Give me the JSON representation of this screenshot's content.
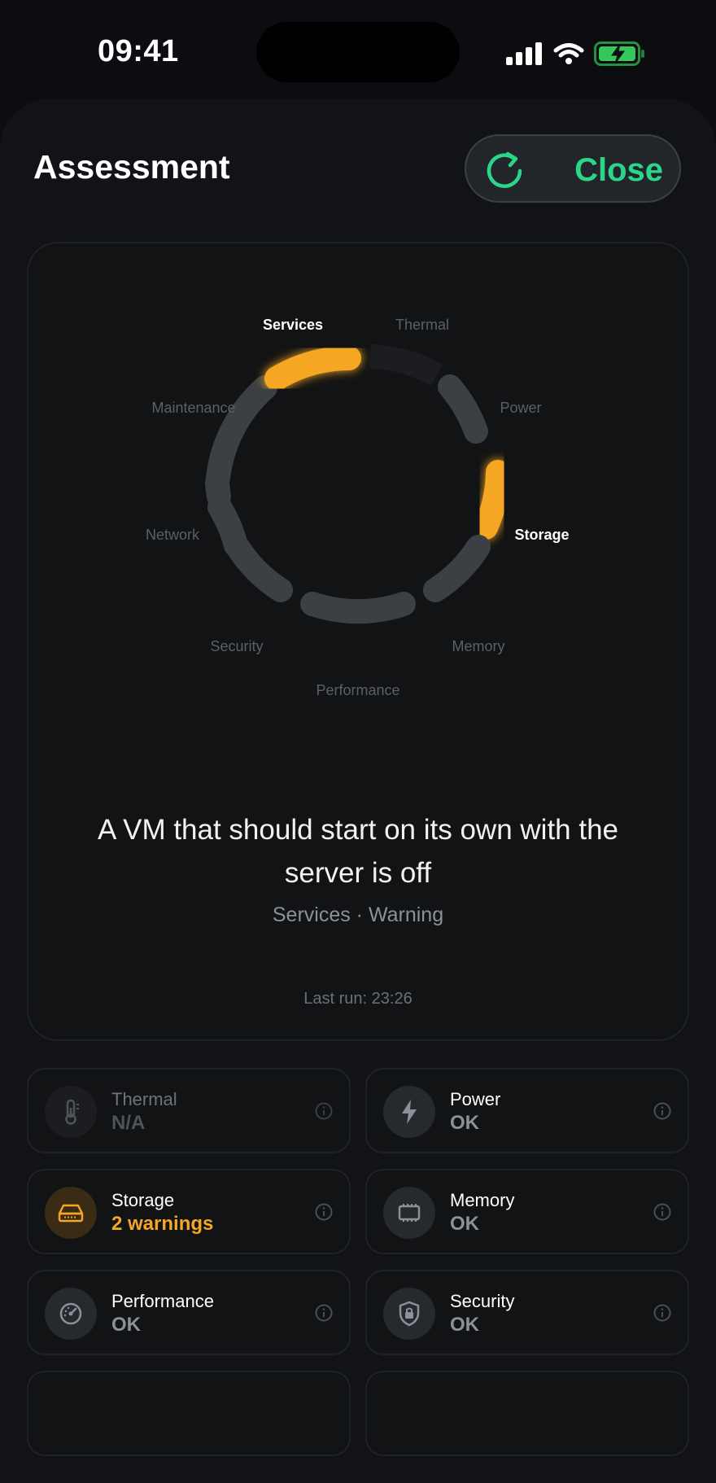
{
  "status": {
    "time": "09:41"
  },
  "header": {
    "title": "Assessment",
    "close_label": "Close"
  },
  "ring": {
    "labels": [
      {
        "key": "services",
        "text": "Services",
        "highlight": true
      },
      {
        "key": "thermal",
        "text": "Thermal",
        "highlight": false
      },
      {
        "key": "power",
        "text": "Power",
        "highlight": false
      },
      {
        "key": "storage",
        "text": "Storage",
        "highlight": true
      },
      {
        "key": "memory",
        "text": "Memory",
        "highlight": false
      },
      {
        "key": "performance",
        "text": "Performance",
        "highlight": false
      },
      {
        "key": "security",
        "text": "Security",
        "highlight": false
      },
      {
        "key": "network",
        "text": "Network",
        "highlight": false
      },
      {
        "key": "maintenance",
        "text": "Maintenance",
        "highlight": false
      }
    ]
  },
  "finding": {
    "headline": "A VM that should start on its own with the server is off",
    "subtitle": "Services · Warning",
    "last_run": "Last run: 23:26"
  },
  "tiles": [
    {
      "name": "Thermal",
      "value": "N/A",
      "icon": "thermometer-icon",
      "state": "dim"
    },
    {
      "name": "Power",
      "value": "OK",
      "icon": "bolt-icon",
      "state": "ok"
    },
    {
      "name": "Storage",
      "value": "2 warnings",
      "icon": "drive-icon",
      "state": "warn"
    },
    {
      "name": "Memory",
      "value": "OK",
      "icon": "chip-icon",
      "state": "ok"
    },
    {
      "name": "Performance",
      "value": "OK",
      "icon": "gauge-icon",
      "state": "ok"
    },
    {
      "name": "Security",
      "value": "OK",
      "icon": "lock-shield-icon",
      "state": "ok"
    }
  ],
  "colors": {
    "accent": "#2ad68a",
    "warning": "#f5a623",
    "segment": "#3c4045",
    "muted": "#5b6067"
  }
}
